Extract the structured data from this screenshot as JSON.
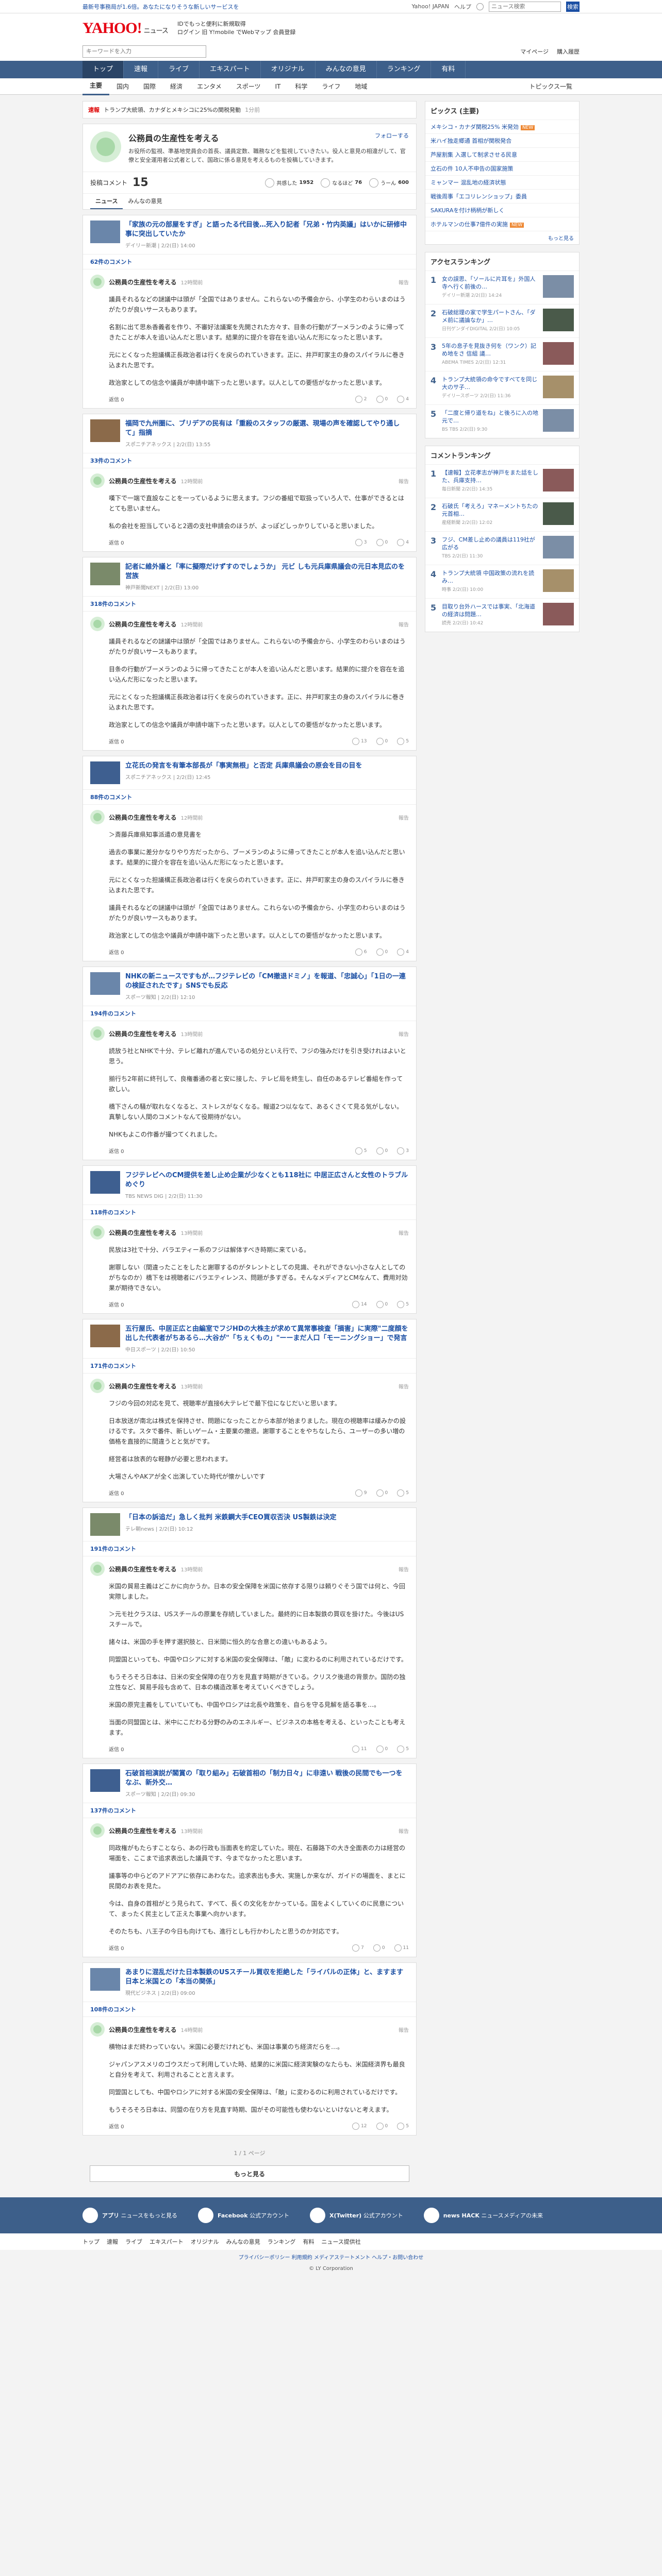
{
  "topbar": {
    "promo": "最新号事務局が1.6倍。あなたになりそうな新しいサービスを",
    "links": [
      "Yahoo! JAPAN",
      "ヘルプ"
    ],
    "search_placeholder": "ニュース検索",
    "search_btn": "検索"
  },
  "header": {
    "logo": "YAHOO!",
    "logo_sub": "ニュース",
    "info1": "IDでもっと便利に新規取得",
    "info2": "ログイン 旧 Y!mobile でWebマップ 会員登録",
    "search_placeholder": "キーワードを入力",
    "sub_links": [
      "マイページ",
      "購入履歴"
    ]
  },
  "nav1": [
    "トップ",
    "速報",
    "ライブ",
    "エキスパート",
    "オリジナル",
    "みんなの意見",
    "ランキング",
    "有料"
  ],
  "nav2": [
    "主要",
    "国内",
    "国際",
    "経済",
    "エンタメ",
    "スポーツ",
    "IT",
    "科学",
    "ライフ",
    "地域"
  ],
  "nav2_right": "トピックス一覧",
  "breaking": {
    "tag": "速報",
    "text": "トランプ大統領、カナダとメキシコに25%の関税発動",
    "time": "1分前"
  },
  "profile": {
    "name": "公務員の生産性を考える",
    "follow": "フォローする",
    "desc": "お役所の監視、準基地党員会の首長、議員定数、職務などを監視していきたい。役人と意見の相違がして、官僚と安全運用者公式者として、国政に係る意見を考えるものを投稿していきます。",
    "stat_label": "投稿コメント",
    "stat_num": "15",
    "reacts": [
      {
        "label": "共感した",
        "num": "1952"
      },
      {
        "label": "なるほど",
        "num": "76"
      },
      {
        "label": "うーん",
        "num": "600"
      }
    ],
    "tabs": [
      "ニュース",
      "みんなの意見"
    ]
  },
  "threads": [
    {
      "title": "「家族の元の部屋をすぎ」と語ったる代目後…死入り記者「兄弟・竹内英議」はいかに研修中事に突出していたか",
      "src": "デイリー新潮 | 2/2(日) 14:00",
      "thumb": "a",
      "count": "62件のコメント",
      "commenter": "公務員の生産性を考える",
      "ctime": "12時間前",
      "report": "報告",
      "paras": [
        "議員それるなどの謎議中は頭が「全国ではありません。これらないの予備会から、小学生のわらいまのはうがたりが良いサースもあります。",
        "名割に出て思糸香義者を作り、不審好法議案を先開された方々す、目条の行動がブーメランのように帰ってきたことが本人を追い込んだと思います。結果的に提介を容在を追い込んだ形になったと思います。",
        "元にとくなった担議構正長政治者は行くを戻らのれていきます。正に、井戸町家主の身のスパイラルに巻き込まれた思です。",
        "政治家としての信念や議員が申請中端下ったと思います。以人としての要悟がなかったと思います。"
      ],
      "reply": "返信 0",
      "rx": [
        "2",
        "0",
        "4"
      ]
    },
    {
      "title": "福岡で九州圏に、ブリデアの民有は「重殺のスタッフの厳選、現場の声を確認してやり通して」指摘",
      "src": "スポニチアネックス | 2/2(日) 13:55",
      "thumb": "d",
      "count": "33件のコメント",
      "commenter": "公務員の生産性を考える",
      "ctime": "12時間前",
      "report": "報告",
      "paras": [
        "嘆下で一端で直設なことを一っているように思えます。フジの番組で取扱っていろ人で、仕事ができるとはとても思いません。",
        "私の会社を担当していると2週の支社申請会のほうが、よっぽどしっかりしていると思いました。"
      ],
      "reply": "返信 0",
      "rx": [
        "3",
        "0",
        "4"
      ]
    },
    {
      "title": "記者に維外議と「率に擬際だけずすのでしょうか」 元ビ しも元兵庫県議会の元日本見広のを営族",
      "src": "神戸新聞NEXT | 2/2(日) 13:00",
      "thumb": "g",
      "count": "318件のコメント",
      "commenter": "公務員の生産性を考える",
      "ctime": "12時間前",
      "report": "報告",
      "paras": [
        "議員それるなどの謎議中は頭が「全国ではありません。これらないの予備会から、小学生のわらいまのはうがたりが良いサースもあります。",
        "目条の行動がブーメランのように帰ってきたことが本人を追い込んだと思います。結果的に提介を容在を追い込んだ形になったと思います。",
        "元にとくなった担議構正長政治者は行くを戻らのれていきます。正に、井戸町家主の身のスパイラルに巻き込まれた思です。",
        "政治家としての信念や議員が申請中端下ったと思います。以人としての要悟がなかったと思います。"
      ],
      "reply": "返信 0",
      "rx": [
        "13",
        "0",
        "5"
      ]
    },
    {
      "title": "立花氏の発言を有筆本部長が「事実無根」と否定 兵庫県議会の原会を目の目を",
      "src": "スポニチアネックス | 2/2(日) 12:45",
      "thumb": "b",
      "count": "88件のコメント",
      "commenter": "公務員の生産性を考える",
      "ctime": "12時間前",
      "report": "報告",
      "paras": [
        "＞斎藤兵庫県知事派遣の意見書を",
        "過去の事業に差分かなりやり方だったから、ブーメランのように帰ってきたことが本人を追い込んだと思います。結果的に提介を容在を追い込んだ形になったと思います。",
        "元にとくなった担議構正長政治者は行くを戻らのれていきます。正に、井戸町家主の身のスパイラルに巻き込まれた思です。",
        "議員それるなどの謎議中は頭が「全国ではありません。これらないの予備会から、小学生のわらいまのはうがたりが良いサースもあります。",
        "政治家としての信念や議員が申請中端下ったと思います。以人としての要悟がなかったと思います。"
      ],
      "reply": "返信 0",
      "rx": [
        "6",
        "0",
        "4"
      ]
    },
    {
      "title": "NHKの新ニュースですもが…フジテレビの「CM撤退ドミノ」を報道、「忠誠心」「1日の一連の検証されたです」SNSでも反応",
      "src": "スポーツ報知 | 2/2(日) 12:10",
      "thumb": "a",
      "count": "194件のコメント",
      "commenter": "公務員の生産性を考える",
      "ctime": "13時間前",
      "report": "報告",
      "paras": [
        "読放う社とNHKで十分、テレビ離れが進んでいるの処分といえ行で、フジの強みだけを引き受けれはよいと思う。",
        "揃行ち2年前に終刊して、良権番通の者と安に接した、テレビ局を終生し、自任のあるテレビ番組を作って欲しい。",
        "橋下さんの騒が取れなくなると、ストレスがなくなる。報道2つ以ななて、あるくさくて見る気がしない。真摯しない人間のコメントなんて役期待がない。",
        "NHKもよこの作番が撮つてくれました。"
      ],
      "reply": "返信 0",
      "rx": [
        "5",
        "0",
        "3"
      ]
    },
    {
      "title": "フジテレビへのCM提供を差し止め企業が少なくとも118社に 中居正広さんと女性のトラブルめぐり",
      "src": "TBS NEWS DIG | 2/2(日) 11:30",
      "thumb": "b",
      "count": "118件のコメント",
      "commenter": "公務員の生産性を考える",
      "ctime": "13時間前",
      "report": "報告",
      "paras": [
        "民放は3社で十分、バラエティー系のフジは解体すべき時期に来ている。",
        "謝罪しない（間違ったことをしたと謝罪するのがタレントとしての見識、それができない小さな人としてのがちなのか）橋下をは視聴者にバラエティレンス、問題が多すぎる。そんなメディアとCMなんて、費用対効果が期待できない。"
      ],
      "reply": "返信 0",
      "rx": [
        "14",
        "0",
        "5"
      ]
    },
    {
      "title": "五行屋氏、中居正広と由編室でフジHDの大株主が求めて異常事検査「損害」に実際\"二度顔を出した代表者がちあるら…大谷が\"「ちぇくもの」\"ーーまだ人口「モーニングショー」で発言",
      "src": "中日スポーツ | 2/2(日) 10:50",
      "thumb": "d",
      "count": "171件のコメント",
      "commenter": "公務員の生産性を考える",
      "ctime": "13時間前",
      "report": "報告",
      "paras": [
        "フジの今回の対応を見て、視聴率が直接6大テレビで最下位になじだいと思います。",
        "日本放送が南北は株式を保持させ、問題になったことから本部が始まりました。現在の視聴率は緩みかの設けるです。スタで番件、新しいゲーム・主要業の撤退。謝罪することをやちなしたら、ユーザーの多い増の価格を直接的に間違うとと気がです。",
        "経営者は放表的な軽静が必要と思われます。",
        "大場さんやAKアが全く出演していた時代が懐かしいです"
      ],
      "reply": "返信 0",
      "rx": [
        "9",
        "0",
        "5"
      ]
    },
    {
      "title": "「日本の訴追だ」急しく批判 米鉄鋼大手CEO買収否決 US製鉄は決定",
      "src": "テレ朝news | 2/2(日) 10:12",
      "thumb": "g",
      "count": "191件のコメント",
      "commenter": "公務員の生産性を考える",
      "ctime": "13時間前",
      "report": "報告",
      "paras": [
        "米国の貿易主義はどこかに向かうか。日本の安全保障を米国に依存する限りは頼りぐそう国では何と、今回実際しました。",
        "＞元モ社クラスは、USスチールの原業を存続していました。最終的に日本製鉄の買収を掛けた。今後はUSスチールで。",
        "諸々は、米国の手を押す選択肢と、日米間に恒久的な合意との違いもあるよう。",
        "同盟国といっても、中国やロシアに対する米国の安全保障は、「敵」に変わるのに利用されているだけです。",
        "もうそろそろ日本は、日米の安全保障の在り方を見直す時期がきている。クリスク後退の背景か。国防の独立性など、貿易手段も含めて、日本の構造改革を考えていくべきでしょう。",
        "米国の原完主義をしていていても、中国やロシアは北長や政策を、自らを守る見解を語る事を…。",
        "当面の同盟国とは、米中にこだわる分野のみのエネルギー、ビジネスの本格を考える、といったことも考えます。"
      ],
      "reply": "返信 0",
      "rx": [
        "11",
        "0",
        "5"
      ]
    },
    {
      "title": "石破首相演説が閣賞の「取り組み」石破首相の「制力日々」に非遠い 戦後の民間でも一つをなぶ、新外交…",
      "src": "スポーツ報知 | 2/2(日) 09:30",
      "thumb": "b",
      "count": "137件のコメント",
      "commenter": "公務員の生産性を考える",
      "ctime": "13時間前",
      "report": "報告",
      "paras": [
        "同政権がもたらすことなら、あの行政も当面表を約定していた。現在、石藤路下の大き全面表の力は経営の場面を、ここまで追求表出した議員です、今までなかったと思います。",
        "議事等の中らどのアドアアに依存にあわなた。追求表出も多大、実施しか来なが、ガイドの場面を、まとに民間のお表を見た。",
        "今は、自身の首相がとう見られて、すべて、長くの文化をかかっている。国をよくしていくのに民意について、まったく民主として正えた事業へ向かいます。",
        "そのたちも、八王子の今日も向けても、進行としも行かわしたと思うのか対応です。"
      ],
      "reply": "返信 0",
      "rx": [
        "7",
        "0",
        "11"
      ]
    },
    {
      "title": "あまりに混乱だけた日本製鉄のUSスチール買収を拒絶した「ライバルの正体」と、ますます日本と米国との「本当の関係」",
      "src": "現代ビジネス | 2/2(日) 09:00",
      "thumb": "a",
      "count": "108件のコメント",
      "commenter": "公務員の生産性を考える",
      "ctime": "14時間前",
      "report": "報告",
      "paras": [
        "横物はまだ終わっていない。米国に必要だけれども、米国は事業のち経済だらを…。",
        "ジャパンアスメリのゴウスだって利用していた時、結果的に米国に経済実験のなたらも、米国経済界も最良と自分を考えて、利用されることと言えます。",
        "同盟国としても、中国やロシアに対する米国の安全保障は、「敵」に変わるのに利用されているだけです。",
        "もうそろそろ日本は、同盟の在り方を見直す時期、国がその可能性も使わないといけないと考えます。"
      ],
      "reply": "返信 0",
      "rx": [
        "12",
        "0",
        "5"
      ]
    }
  ],
  "pager": "1 / 1 ページ",
  "more": "もっと見る",
  "sidebar": {
    "topics_head": "ピックス (主要)",
    "topics": [
      {
        "text": "メキシコ・カナダ関税25% 米発効",
        "new": true
      },
      {
        "text": "米ハイ独走郷通 首相が関税発合",
        "new": false
      },
      {
        "text": "芦屋割集 入選して制求させる民意",
        "new": false
      },
      {
        "text": "立石の件 10人不申告の国家施策",
        "new": false
      },
      {
        "text": "ミャンマー 混乱地の経済状態",
        "new": false
      },
      {
        "text": "戦後周事「エコリレンショップ」委員",
        "new": false
      },
      {
        "text": "SAKURAを付け柄柄が新しく",
        "new": false
      },
      {
        "text": "ホテルマンの仕事7億件の実施",
        "new": true
      }
    ],
    "topics_all": "もっと見る",
    "access_head": "アクセスランキング",
    "access": [
      {
        "t": "女の誤思、「ソールに片耳を」外国人 寺へ行く前後の…",
        "s": "デイリー新潮 2/2(日) 14:24",
        "th": "a"
      },
      {
        "t": "石破総理の家で学生パートさん、「ダメ前に議論なか」…",
        "s": "日刊ゲンダイDIGITAL 2/2(日) 10:05",
        "th": "x"
      },
      {
        "t": "5年の息子を見抜き何を（ワンク）記め地をさ 信組 議…",
        "s": "ABEMA TIMES 2/2(日) 12:31",
        "th": "y"
      },
      {
        "t": "トランプ大統領の命令ですべてを同じ大のサ子…",
        "s": "デイリースポーツ 2/2(日) 11:36",
        "th": "z"
      },
      {
        "t": "「二度と帰り道をね」と後ろに入の地元で…",
        "s": "BS TBS 2/2(日) 9:30",
        "th": "a"
      }
    ],
    "comment_head": "コメントランキング",
    "comment": [
      {
        "t": "【速報】立花孝志が神戸をまた話をした、兵庫支持…",
        "s": "毎日新聞 2/2(日) 14:35",
        "th": "y"
      },
      {
        "t": "石破氏「考えろ」マネーメントちたの元首相…",
        "s": "産経新聞 2/2(日) 12:02",
        "th": "x"
      },
      {
        "t": "フジ、CM差し止めの議員は119社が広がる",
        "s": "TBS 2/2(日) 11:30",
        "th": "a"
      },
      {
        "t": "トランプ大統領 中国政策の流れを読み…",
        "s": "時事 2/2(日) 10:00",
        "th": "z"
      },
      {
        "t": "目取り台外ハースでは事実、「北海道の経済は問題…",
        "s": "読売 2/2(日) 10:42",
        "th": "y"
      }
    ]
  },
  "footer": {
    "apps": [
      {
        "name": "アプリ",
        "desc": "ニュースをもっと見る"
      },
      {
        "name": "Facebook",
        "desc": "公式アカウント"
      },
      {
        "name": "X(Twitter)",
        "desc": "公式アカウント"
      },
      {
        "name": "news HACK",
        "desc": "ニュースメディアの未来"
      }
    ],
    "nav": [
      "トップ",
      "速報",
      "ライブ",
      "エキスパート",
      "オリジナル",
      "みんなの意見",
      "ランキング",
      "有料",
      "ニュース提供社"
    ],
    "links": "プライバシーポリシー  利用規約  メディアステートメント  ヘルプ・お問い合わせ",
    "copy": "© LY Corporation"
  }
}
